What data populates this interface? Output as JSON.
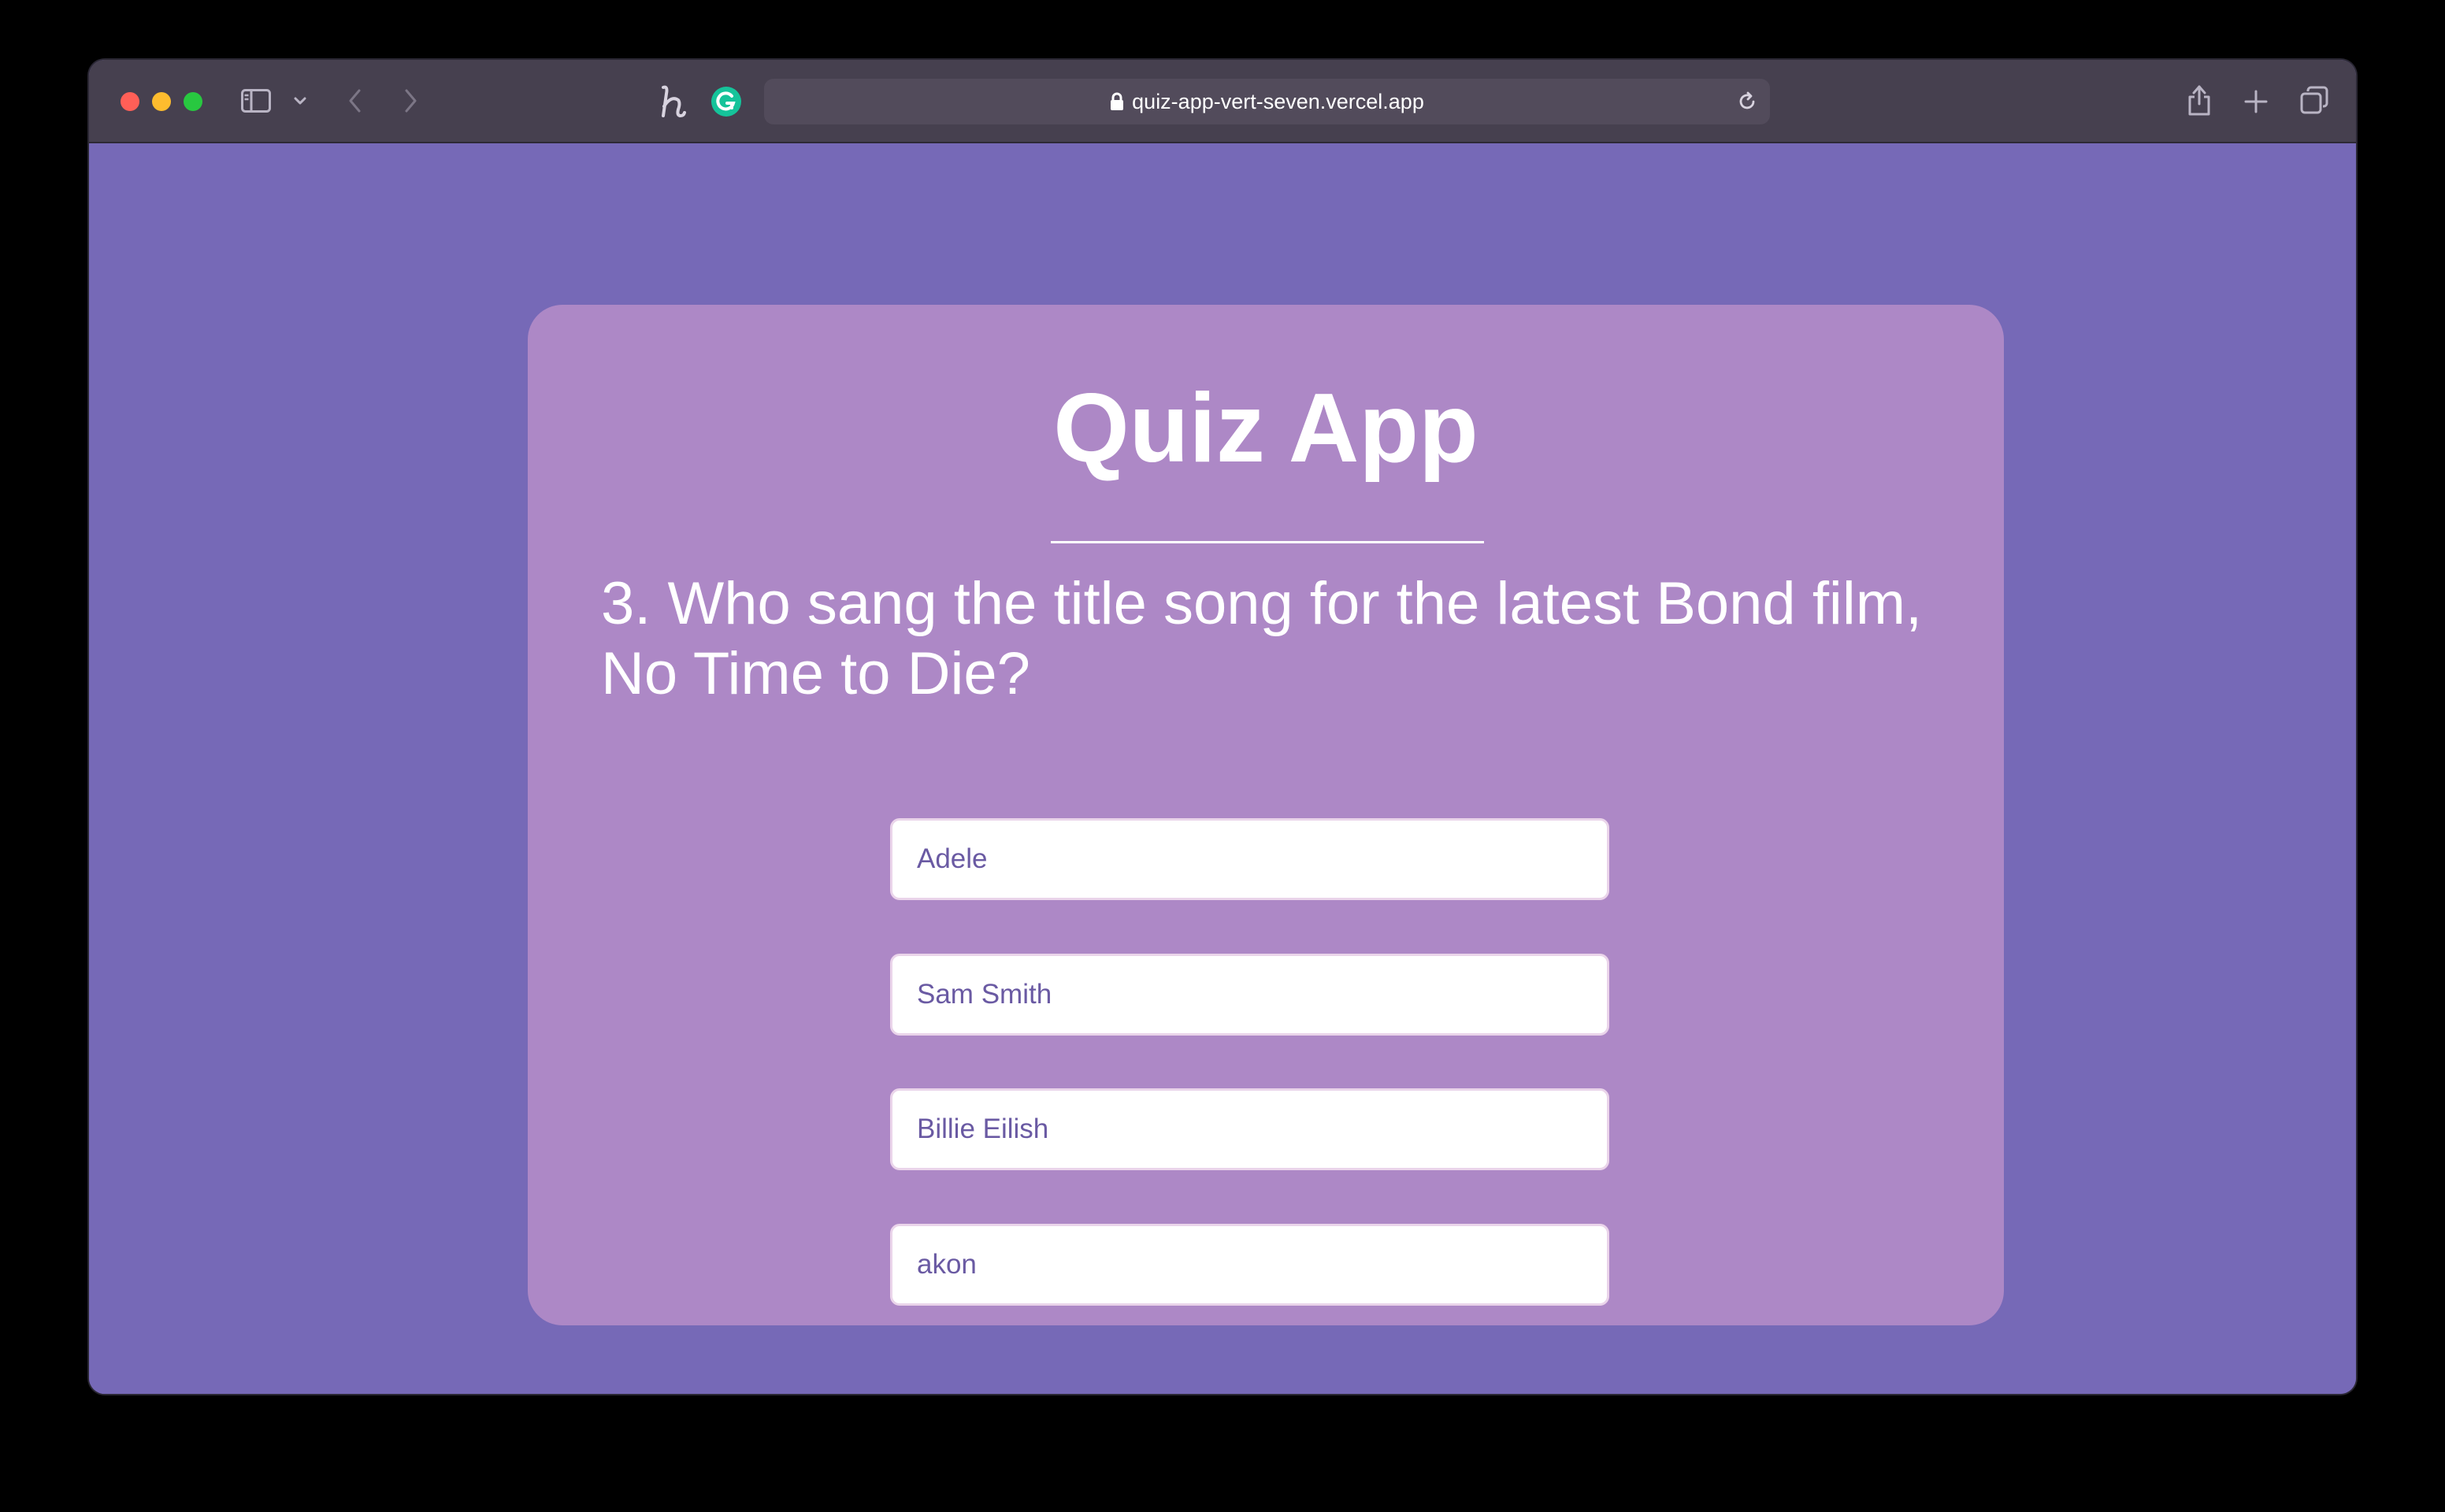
{
  "browser": {
    "url": "quiz-app-vert-seven.vercel.app"
  },
  "quiz": {
    "title": "Quiz App",
    "question": "3. Who sang the title song for the latest Bond film, No Time to Die?",
    "answers": [
      "Adele",
      "Sam Smith",
      "Billie Eilish",
      "akon"
    ]
  },
  "colors": {
    "page_background": "#7669b7",
    "card_background": "#ad88c6",
    "answer_text": "#6a5aa3",
    "toolbar": "#46404f"
  },
  "icons": [
    "close-icon",
    "minimize-icon",
    "maximize-icon",
    "sidebar-icon",
    "chevron-down-icon",
    "back-icon",
    "forward-icon",
    "honey-extension-icon",
    "grammarly-extension-icon",
    "lock-icon",
    "reload-icon",
    "share-icon",
    "new-tab-icon",
    "tab-overview-icon"
  ]
}
